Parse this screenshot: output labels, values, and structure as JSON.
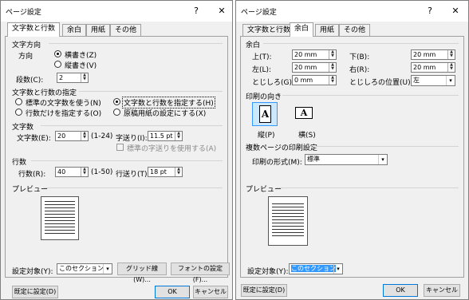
{
  "left": {
    "title": "ページ設定",
    "help": "?",
    "close": "✕",
    "tabs": [
      "文字数と行数",
      "余白",
      "用紙",
      "その他"
    ],
    "direction": {
      "header": "文字方向",
      "label": "方向",
      "horizontal": "横書き(Z)",
      "vertical": "縦書き(V)",
      "columns_label": "段数(C):",
      "columns_value": "2"
    },
    "grid": {
      "header": "文字数と行数の指定",
      "opt1": "標準の文字数を使う(N)",
      "opt2": "文字数と行数を指定する(H)",
      "opt3": "行数だけを指定する(O)",
      "opt4": "原稿用紙の設定にする(X)"
    },
    "chars": {
      "header": "文字数",
      "label": "文字数(E):",
      "value": "20",
      "range": "(1-24)",
      "pitch_label": "字送り(I):",
      "pitch_value": "11.5 pt",
      "default_pitch": "標準の字送りを使用する(A)"
    },
    "lines": {
      "header": "行数",
      "label": "行数(R):",
      "value": "40",
      "range": "(1-50)",
      "pitch_label": "行送り(T):",
      "pitch_value": "18 pt"
    },
    "preview": "プレビュー",
    "apply_label": "設定対象(Y):",
    "apply_value": "このセクション",
    "grid_btn": "グリッド線(W)...",
    "font_btn": "フォントの設定(F)...",
    "default_btn": "既定に設定(D)",
    "ok": "OK",
    "cancel": "キャンセル"
  },
  "right": {
    "title": "ページ設定",
    "help": "?",
    "close": "✕",
    "tabs": [
      "文字数と行数",
      "余白",
      "用紙",
      "その他"
    ],
    "margins": {
      "header": "余白",
      "top_label": "上(T):",
      "top_value": "20 mm",
      "bottom_label": "下(B):",
      "bottom_value": "20 mm",
      "left_label": "左(L):",
      "left_value": "20 mm",
      "right_label": "右(R):",
      "right_value": "20 mm",
      "gutter_label": "とじしろ(G):",
      "gutter_value": "0 mm",
      "gutter_pos_label": "とじしろの位置(U):",
      "gutter_pos_value": "左"
    },
    "orientation": {
      "header": "印刷の向き",
      "portrait": "縦(P)",
      "landscape": "横(S)",
      "glyph": "A"
    },
    "pages": {
      "header": "複数ページの印刷設定",
      "label": "印刷の形式(M):",
      "value": "標準"
    },
    "preview": "プレビュー",
    "apply_label": "設定対象(Y):",
    "apply_value": "このセクション",
    "default_btn": "既定に設定(D)",
    "ok": "OK",
    "cancel": "キャンセル"
  },
  "colors": {
    "dialog_bg": "#f0f0f0",
    "accent": "#0078d7",
    "selection": "#3399ff"
  }
}
